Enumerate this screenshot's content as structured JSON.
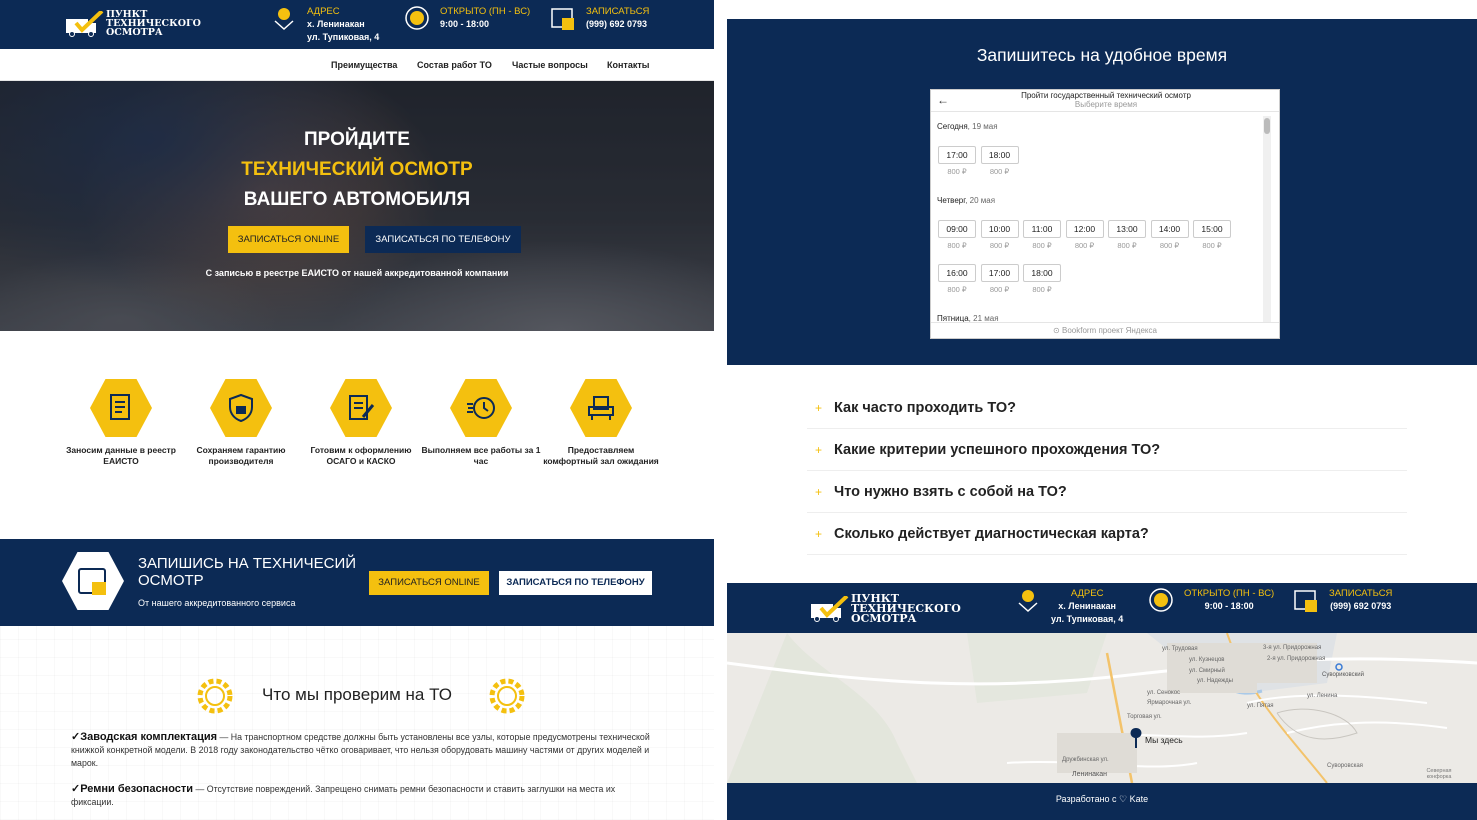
{
  "brand": {
    "name_line1": "Пункт",
    "name_line2": "технического",
    "name_line3": "осмотра"
  },
  "header": {
    "address_label": "АДРЕС",
    "address_line1": "х. Ленинакан",
    "address_line2": "ул. Тупиковая, 4",
    "hours_label": "ОТКРЫТО (ПН - ВС)",
    "hours_value": "9:00 - 18:00",
    "book_label": "ЗАПИСАТЬСЯ",
    "phone": "(999) 692 0793"
  },
  "nav": {
    "items": [
      "Преимущества",
      "Состав работ ТО",
      "Частые вопросы",
      "Контакты"
    ]
  },
  "hero": {
    "line1": "Пройдите",
    "line2": "технический осмотр",
    "line3": "вашего автомобиля",
    "btn_online": "Записаться online",
    "btn_phone": "Записаться по телефону",
    "subtitle": "С записью в реестре ЕАИСТО от нашей аккредитованной компании"
  },
  "features": [
    {
      "label": "Заносим данные в реестр ЕАИСТО",
      "icon": "document-icon"
    },
    {
      "label": "Сохраняем гарантию производителя",
      "icon": "shield-lock-icon"
    },
    {
      "label": "Готовим к оформлению ОСАГО и КАСКО",
      "icon": "contract-pen-icon"
    },
    {
      "label": "Выполняем все работы за 1 час",
      "icon": "fast-clock-icon"
    },
    {
      "label": "Предоставляем комфортный зал ожидания",
      "icon": "armchair-icon"
    }
  ],
  "cta": {
    "title": "Запишись на техничесий осмотр",
    "subtitle": "От нашего аккредитованного сервиса",
    "btn_online": "Записаться online",
    "btn_phone": "Записаться по телефону"
  },
  "checks": {
    "title": "Что мы проверим на ТО",
    "items": [
      {
        "title": "Заводская комплектация",
        "text": " — На транспортном средстве должны быть установлены все узлы, которые предусмотрены технической книжкой конкретной модели. В 2018 году законодательство чётко оговаривает, что нельзя оборудовать машину частями от других моделей и марок."
      },
      {
        "title": "Ремни безопасности",
        "text": " — Отсутствие повреждений. Запрещено снимать ремни безопасности и ставить заглушки на места их фиксации."
      }
    ]
  },
  "booking": {
    "title": "Запишитесь на удобное время",
    "widget_title": "Пройти государственный технический осмотр",
    "widget_subtitle": "Выберите время",
    "days": [
      {
        "day": "Сегодня",
        "date": ", 19 мая",
        "slots": [
          [
            "17:00",
            "800 ₽"
          ],
          [
            "18:00",
            "800 ₽"
          ]
        ]
      },
      {
        "day": "Четверг",
        "date": ", 20 мая",
        "slots": [
          [
            "09:00",
            "800 ₽"
          ],
          [
            "10:00",
            "800 ₽"
          ],
          [
            "11:00",
            "800 ₽"
          ],
          [
            "12:00",
            "800 ₽"
          ],
          [
            "13:00",
            "800 ₽"
          ],
          [
            "14:00",
            "800 ₽"
          ],
          [
            "15:00",
            "800 ₽"
          ],
          [
            "16:00",
            "800 ₽"
          ],
          [
            "17:00",
            "800 ₽"
          ],
          [
            "18:00",
            "800 ₽"
          ]
        ]
      },
      {
        "day": "Пятница",
        "date": ", 21 мая",
        "slots": []
      }
    ],
    "footer": "Bookform проект Яндекса"
  },
  "faq": [
    "Как часто проходить ТО?",
    "Какие критерии успешного прохождения ТО?",
    "Что нужно взять с собой на ТО?",
    "Сколько действует диагностическая карта?"
  ],
  "map": {
    "marker_label": "Мы здесь",
    "labels": [
      "Торговая ул.",
      "Ярмарочная ул.",
      "Дружбинская ул.",
      "Ленинакан",
      "ул. Сенокос",
      "ул. Трудовая",
      "ул. Кузнецов",
      "ул. Смирный",
      "ул. Надежды",
      "3-я ул. Придорожная",
      "2-я ул. Придорожная",
      "ул. Ленина",
      "Сувориковский",
      "ул. Пятая",
      "Суворовская",
      "Северная конфорка"
    ]
  },
  "footer": {
    "text": "Разработано с ♡ Kate"
  },
  "colors": {
    "navy": "#0c2a55",
    "gold": "#f4c00f"
  }
}
